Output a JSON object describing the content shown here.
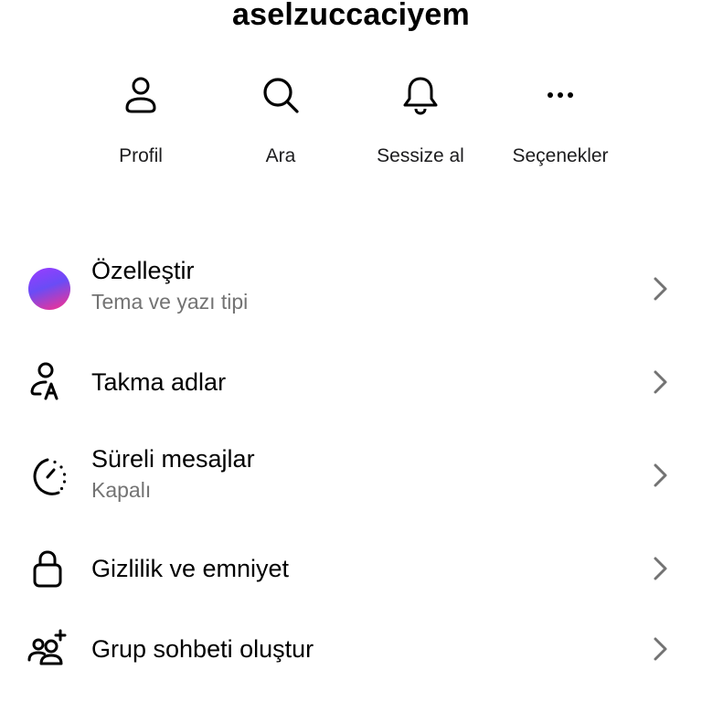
{
  "header": {
    "title": "aselzuccaciyem"
  },
  "actions": [
    {
      "label": "Profil",
      "icon": "person-icon"
    },
    {
      "label": "Ara",
      "icon": "search-icon"
    },
    {
      "label": "Sessize al",
      "icon": "bell-icon"
    },
    {
      "label": "Seçenekler",
      "icon": "more-horizontal-icon"
    }
  ],
  "settings": [
    {
      "title": "Özelleştir",
      "subtitle": "Tema ve yazı tipi",
      "icon": "theme-gradient-icon"
    },
    {
      "title": "Takma adlar",
      "icon": "nickname-icon"
    },
    {
      "title": "Süreli mesajlar",
      "subtitle": "Kapalı",
      "icon": "timer-icon"
    },
    {
      "title": "Gizlilik ve emniyet",
      "icon": "lock-icon"
    },
    {
      "title": "Grup sohbeti oluştur",
      "icon": "add-group-icon"
    }
  ],
  "colors": {
    "text": "#000000",
    "secondary_text": "#737373",
    "chevron": "#737373",
    "gradient_start": "#9b3bff",
    "gradient_end": "#ff2f8a"
  }
}
